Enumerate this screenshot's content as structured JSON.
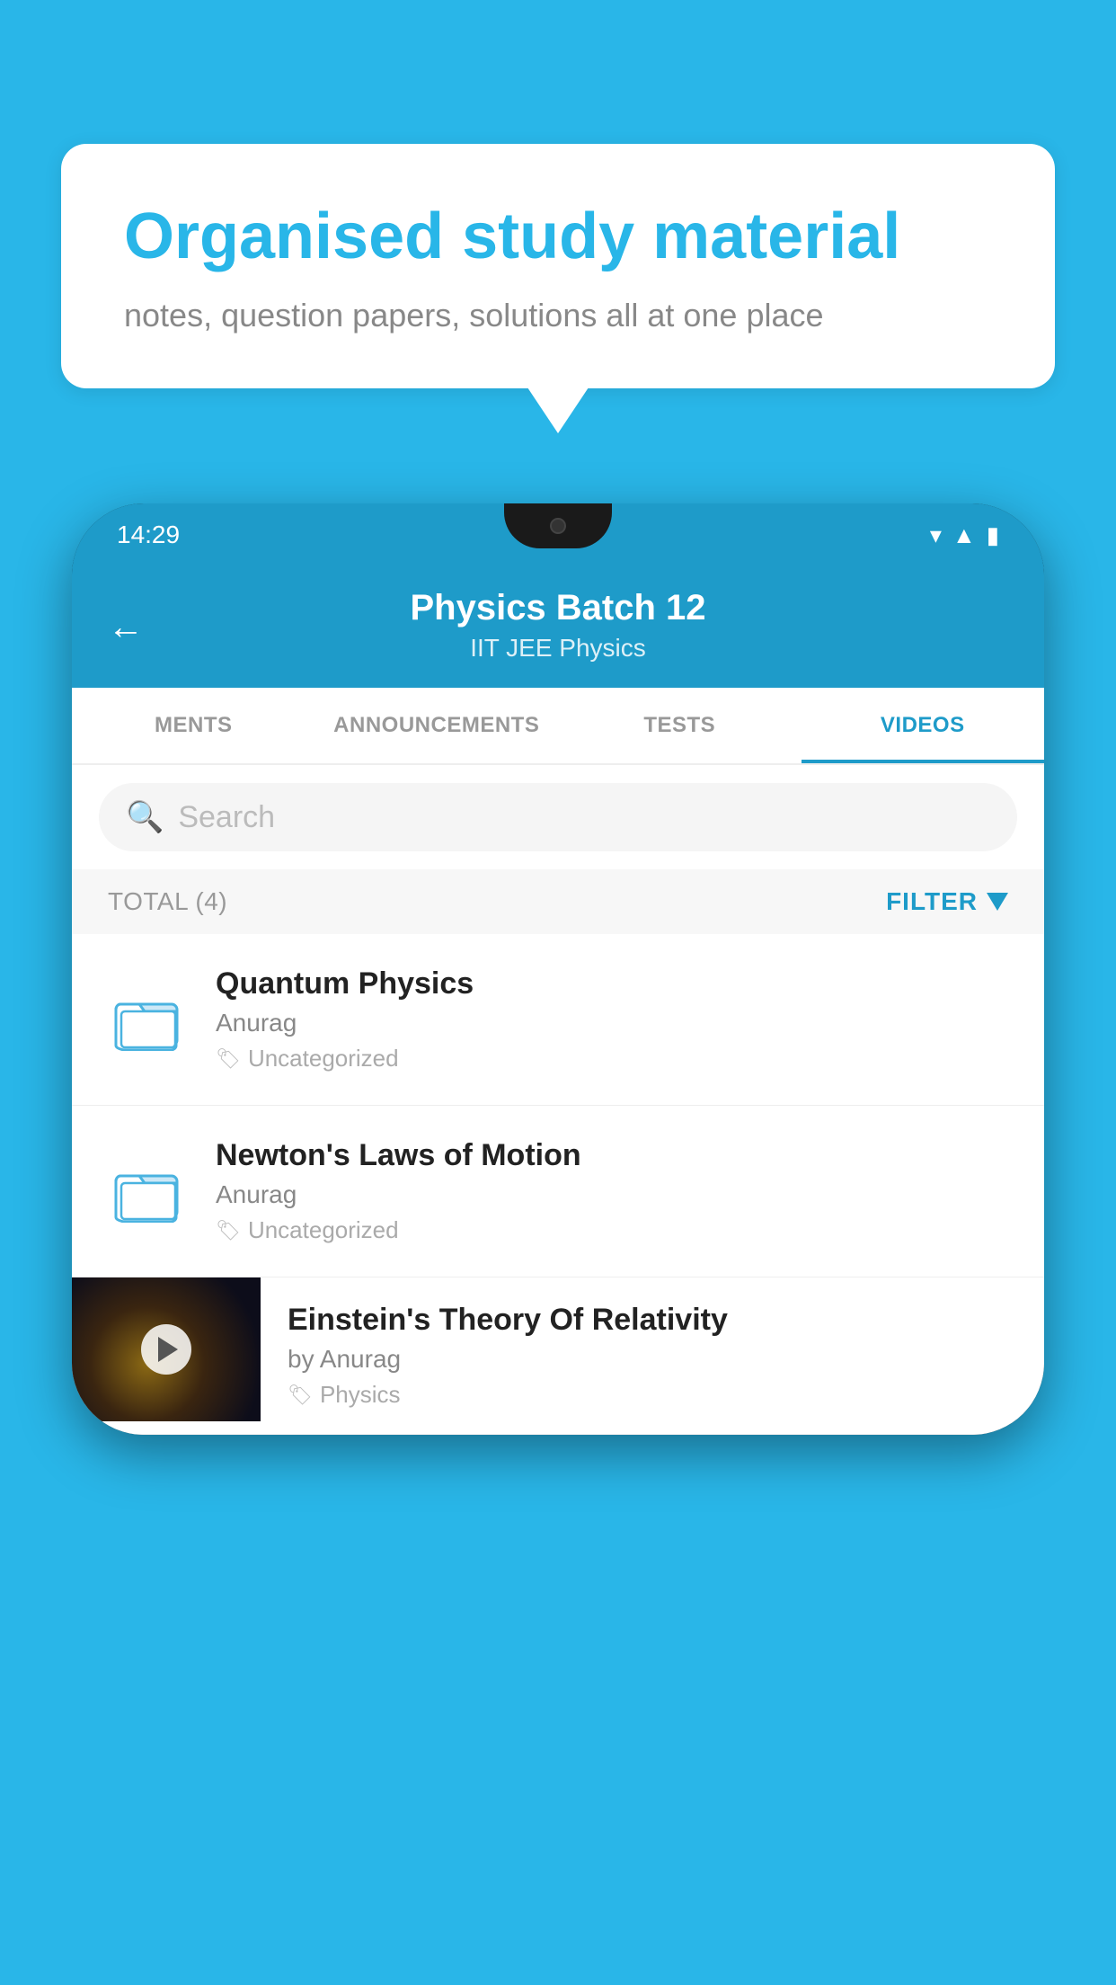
{
  "bubble": {
    "heading": "Organised study material",
    "subtext": "notes, question papers, solutions all at one place"
  },
  "phone": {
    "status_bar": {
      "time": "14:29"
    },
    "header": {
      "title": "Physics Batch 12",
      "subtitle": "IIT JEE   Physics",
      "back_label": "←"
    },
    "tabs": [
      {
        "label": "MENTS",
        "active": false
      },
      {
        "label": "ANNOUNCEMENTS",
        "active": false
      },
      {
        "label": "TESTS",
        "active": false
      },
      {
        "label": "VIDEOS",
        "active": true
      }
    ],
    "search": {
      "placeholder": "Search"
    },
    "filter_bar": {
      "total": "TOTAL (4)",
      "filter_label": "FILTER"
    },
    "videos": [
      {
        "id": "quantum-physics",
        "type": "folder",
        "title": "Quantum Physics",
        "author": "Anurag",
        "tag": "Uncategorized"
      },
      {
        "id": "newtons-laws",
        "type": "folder",
        "title": "Newton's Laws of Motion",
        "author": "Anurag",
        "tag": "Uncategorized"
      },
      {
        "id": "einstein-relativity",
        "type": "thumbnail",
        "title": "Einstein's Theory Of Relativity",
        "author": "by Anurag",
        "tag": "Physics"
      }
    ]
  }
}
